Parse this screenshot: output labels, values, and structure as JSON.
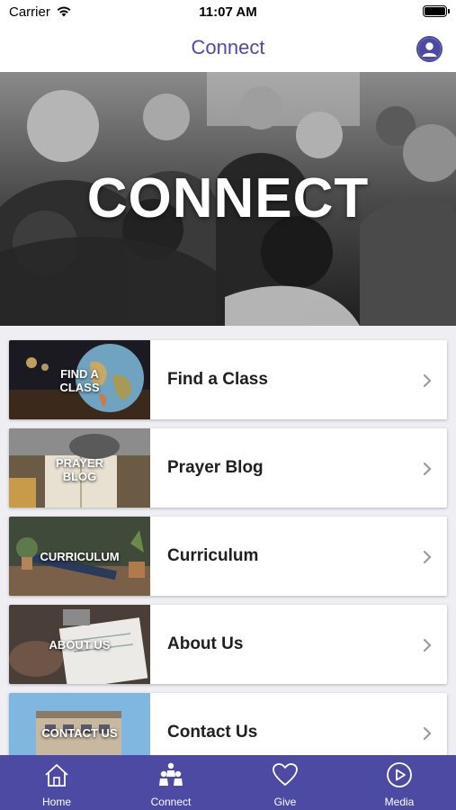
{
  "status_bar": {
    "carrier": "Carrier",
    "time": "11:07 AM"
  },
  "header": {
    "title": "Connect"
  },
  "hero": {
    "title": "CONNECT"
  },
  "list": {
    "items": [
      {
        "thumb_line1": "FIND A",
        "thumb_line2": "CLASS",
        "label": "Find a Class"
      },
      {
        "thumb_line1": "PRAYER",
        "thumb_line2": "BLOG",
        "label": "Prayer Blog"
      },
      {
        "thumb_line1": "CURRICULUM",
        "label": "Curriculum"
      },
      {
        "thumb_line1": "ABOUT US",
        "label": "About Us"
      },
      {
        "thumb_line1": "CONTACT US",
        "label": "Contact Us"
      }
    ]
  },
  "tab_bar": {
    "tabs": [
      {
        "label": "Home",
        "icon": "home-icon"
      },
      {
        "label": "Connect",
        "icon": "people-icon"
      },
      {
        "label": "Give",
        "icon": "heart-icon"
      },
      {
        "label": "Media",
        "icon": "play-icon"
      }
    ]
  },
  "colors": {
    "brand": "#4c4aa3",
    "tab_bar": "#4c4aa3",
    "background": "#efeff3"
  }
}
